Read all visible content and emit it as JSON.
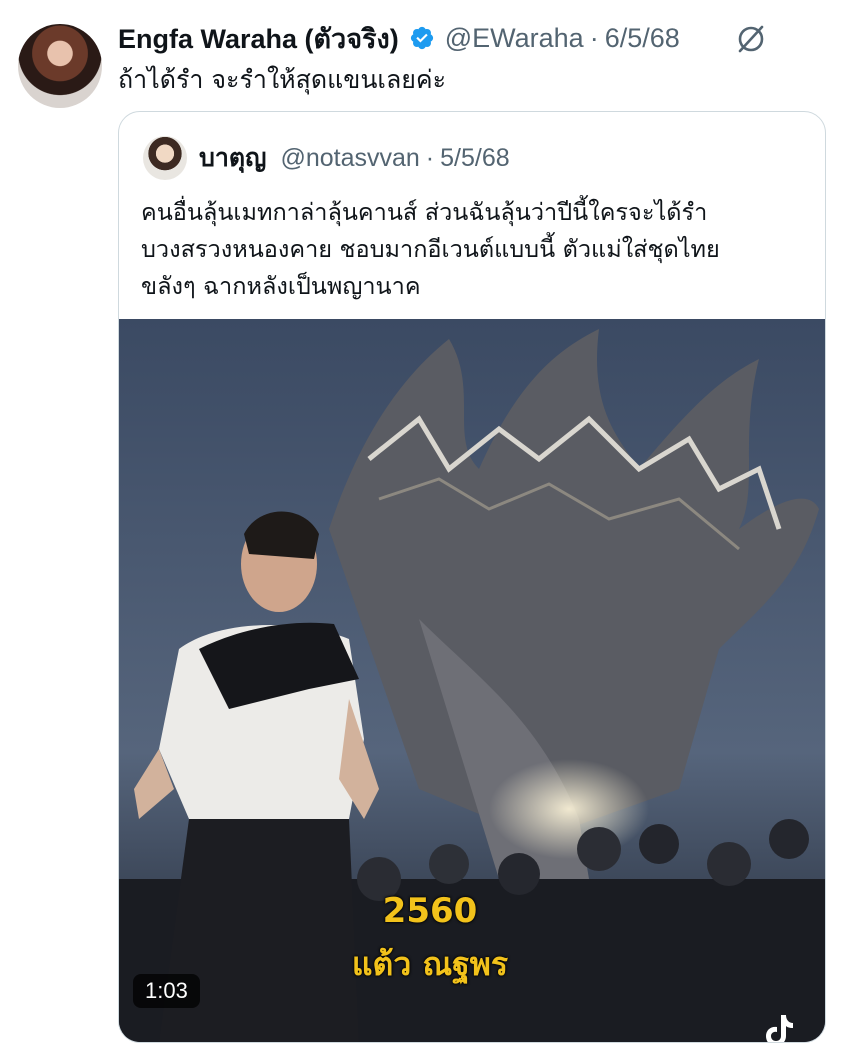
{
  "tweet": {
    "author_name": "Engfa Waraha (ตัวจริง)",
    "handle": "@EWaraha",
    "separator": "·",
    "date": "6/5/68",
    "text": "ถ้าได้รำ จะรำให้สุดแขนเลยค่ะ",
    "avatar_icon": "profile-photo",
    "verified_icon": "verified-badge-icon",
    "more_icon": "grok-icon"
  },
  "quote": {
    "author_name": "บาตุญ",
    "handle": "@notasvvan",
    "separator": "·",
    "date": "5/5/68",
    "text_lines": [
      "คนอื่นลุ้นเมทกาล่าลุ้นคานส์ ส่วนฉันลุ้นว่าปีนี้ใครจะได้รำ",
      "บวงสรวงหนองคาย ชอบมากอีเวนต์แบบนี้ ตัวแม่ใส่ชุดไทย",
      "ขลังๆ ฉากหลังเป็นพญานาค"
    ],
    "media": {
      "caption_year": "2560",
      "caption_name": "แต้ว ณฐพร",
      "duration": "1:03"
    }
  },
  "colors": {
    "text": "#0f1419",
    "muted": "#536471",
    "verified": "#1d9bf0",
    "border": "#cfd9de",
    "caption": "#f2c21b"
  }
}
